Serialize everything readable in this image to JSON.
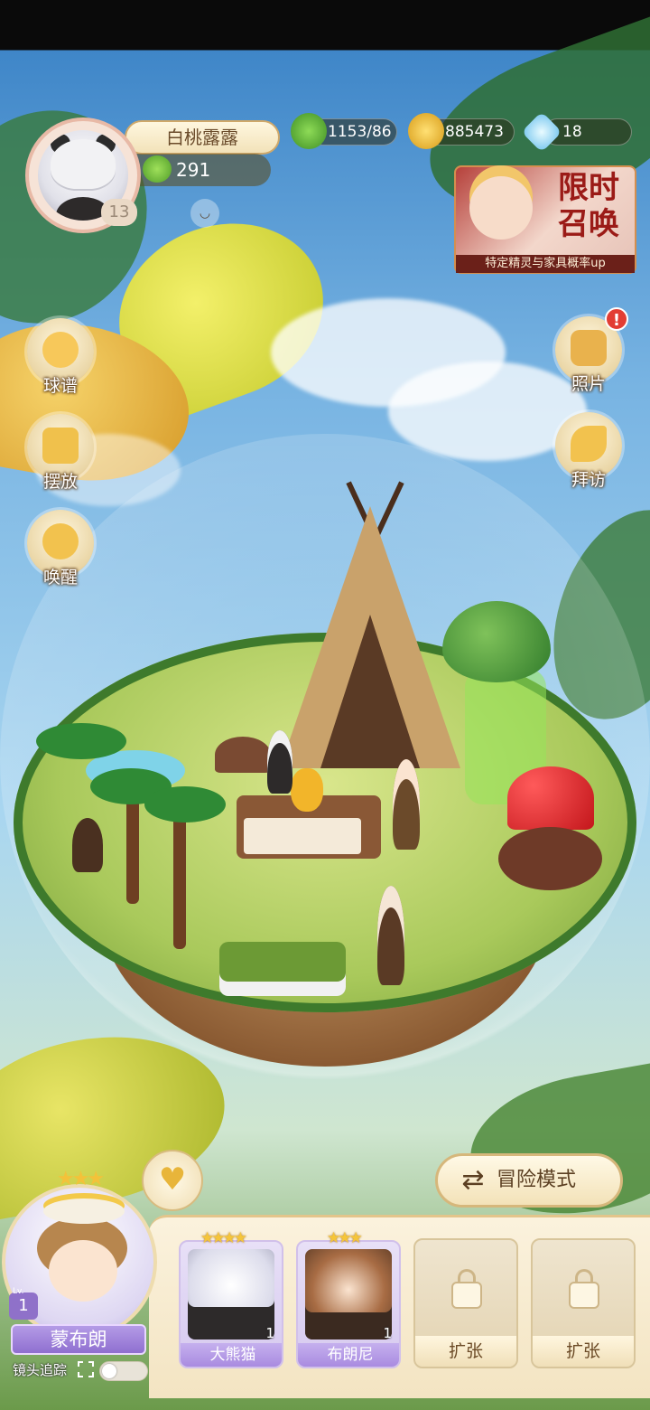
{
  "player": {
    "name": "白桃露露",
    "level": "13",
    "leaf_points": "291"
  },
  "currencies": {
    "clover": "1153/86",
    "gold": "885473",
    "crystal": "18"
  },
  "event_banner": {
    "title": "限时召唤",
    "subtitle": "特定精灵与家具概率up"
  },
  "left_menu": {
    "recipes": "球谱",
    "place": "摆放",
    "awaken": "唤醒"
  },
  "right_menu": {
    "photos": "照片",
    "visit": "拜访",
    "photo_notice": "!"
  },
  "adventure_mode": {
    "label": "冒险模式"
  },
  "main_spirit": {
    "name": "蒙布朗",
    "level": "1",
    "level_prefix": "Lv."
  },
  "camera_follow": {
    "label": "镜头追踪",
    "enabled": false
  },
  "spirit_cards": [
    {
      "name": "大熊猫",
      "count": "1",
      "stars": "★★★★"
    },
    {
      "name": "布朗尼",
      "count": "1",
      "stars": "★★★"
    }
  ],
  "locked_slots": [
    {
      "label": "扩张"
    },
    {
      "label": "扩张"
    }
  ]
}
